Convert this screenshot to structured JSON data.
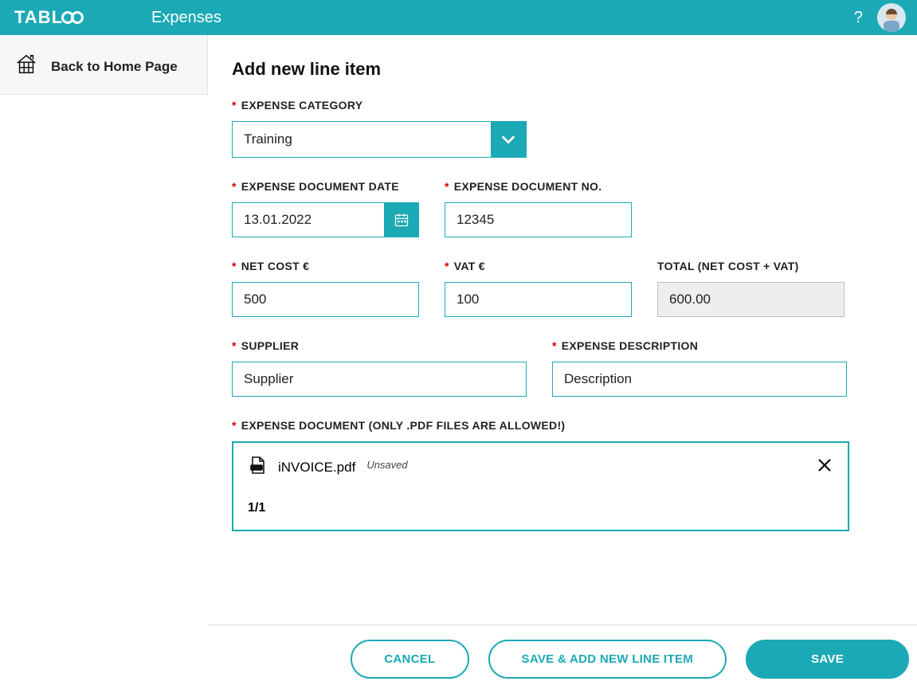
{
  "header": {
    "brand": "TABLOO",
    "page_title": "Expenses"
  },
  "sidebar": {
    "back_label": "Back to Home Page"
  },
  "form": {
    "title": "Add new line item",
    "labels": {
      "category": "EXPENSE CATEGORY",
      "doc_date": "EXPENSE DOCUMENT DATE",
      "doc_no": "EXPENSE DOCUMENT NO.",
      "net_cost": "NET COST €",
      "vat": "VAT €",
      "total": "TOTAL (NET COST + VAT)",
      "supplier": "SUPPLIER",
      "description": "EXPENSE DESCRIPTION",
      "document": "EXPENSE DOCUMENT (ONLY .PDF FILES ARE ALLOWED!)"
    },
    "values": {
      "category": "Training",
      "doc_date": "13.01.2022",
      "doc_no": "12345",
      "net_cost": "500",
      "vat": "100",
      "total": "600.00",
      "supplier": "Supplier",
      "description": "Description"
    },
    "file": {
      "name": "iNVOICE.pdf",
      "status": "Unsaved",
      "counter": "1/1"
    }
  },
  "buttons": {
    "cancel": "CANCEL",
    "save_add": "SAVE & ADD NEW LINE ITEM",
    "save": "SAVE"
  }
}
